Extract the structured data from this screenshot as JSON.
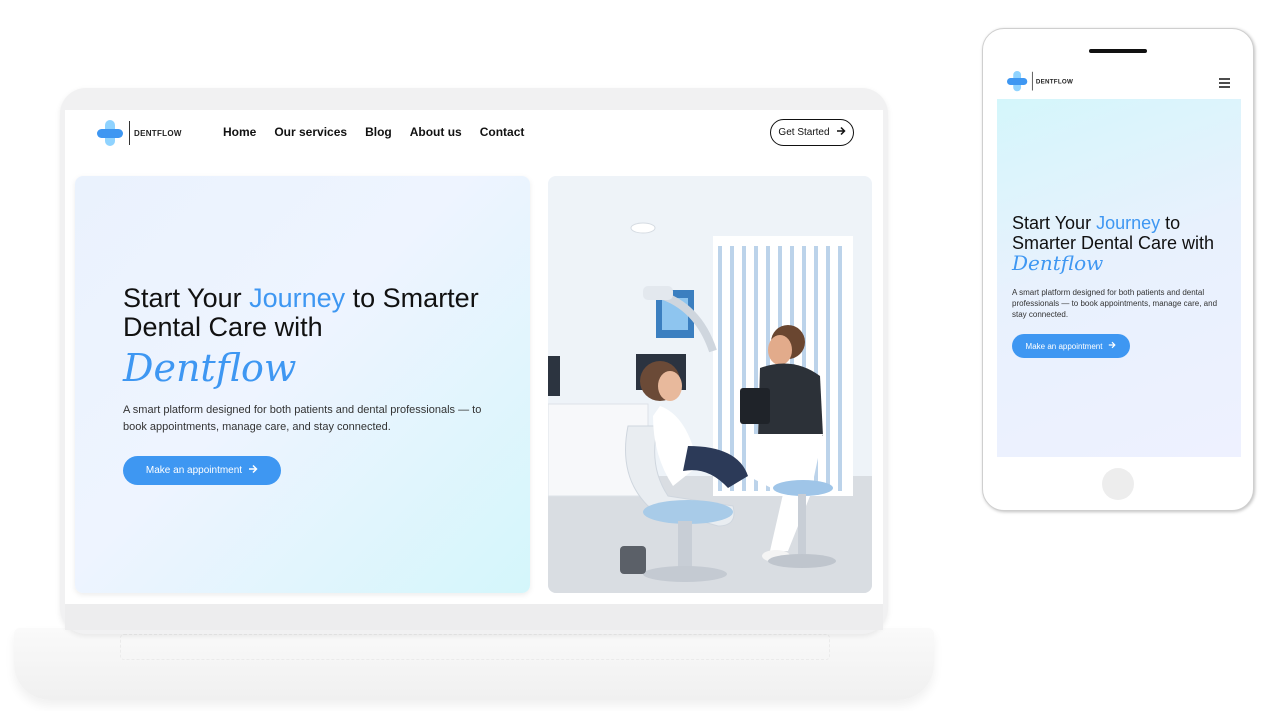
{
  "brand": {
    "name": "DENTFLOW",
    "primary_color": "#3e97f2",
    "light_color": "#8fd3ff"
  },
  "nav": {
    "links": [
      "Home",
      "Our services",
      "Blog",
      "About us",
      "Contact"
    ],
    "cta_label": "Get Started"
  },
  "hero": {
    "title_part1": "Start Your ",
    "title_accent": "Journey",
    "title_part2_desktop": " to Smarter Dental Care with",
    "title_part2_tablet_line": " to Smarter Dental Care with ",
    "script_word": "Dentflow",
    "subtitle": "A smart platform designed for both patients and dental professionals — to book appointments, manage care, and stay connected.",
    "button_label": "Make an appointment"
  },
  "icons": {
    "arrow": "arrow-right-icon",
    "menu": "hamburger-menu-icon"
  }
}
